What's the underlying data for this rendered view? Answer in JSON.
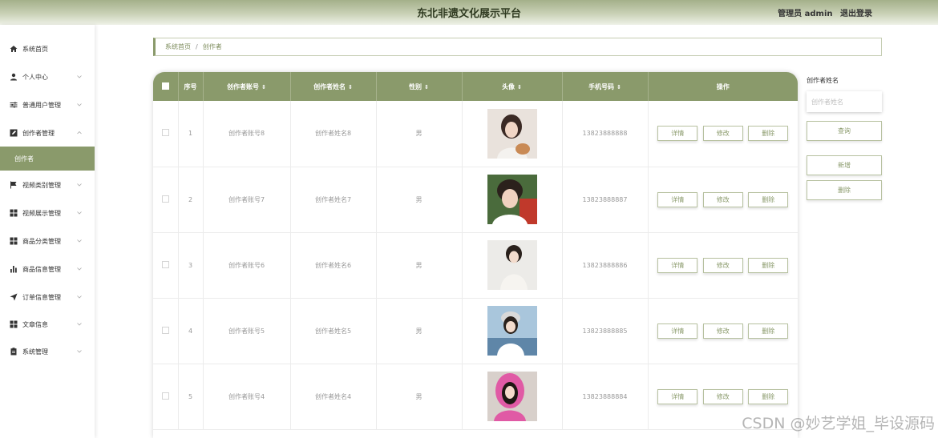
{
  "header": {
    "title": "东北非遗文化展示平台",
    "user": "管理员 admin",
    "logout": "退出登录"
  },
  "colors": {
    "accent": "#8a9a6b",
    "header_gradient_top": "#a4b08a"
  },
  "sidebar": {
    "items": [
      {
        "label": "系统首页",
        "icon": "home-icon"
      },
      {
        "label": "个人中心",
        "icon": "user-icon"
      },
      {
        "label": "普通用户管理",
        "icon": "sliders-icon"
      },
      {
        "label": "创作者管理",
        "icon": "edit-box-icon"
      },
      {
        "label": "创作者",
        "icon": ""
      },
      {
        "label": "视频类别管理",
        "icon": "flag-icon"
      },
      {
        "label": "视频展示管理",
        "icon": "grid-icon"
      },
      {
        "label": "商品分类管理",
        "icon": "grid-icon"
      },
      {
        "label": "商品信息管理",
        "icon": "bar-chart-icon"
      },
      {
        "label": "订单信息管理",
        "icon": "send-icon"
      },
      {
        "label": "文章信息",
        "icon": "grid-icon"
      },
      {
        "label": "系统管理",
        "icon": "clipboard-icon"
      }
    ]
  },
  "breadcrumb": {
    "home": "系统首页",
    "separator": "/",
    "current": "创作者"
  },
  "table": {
    "columns": {
      "index": "序号",
      "account": "创作者账号",
      "name": "创作者姓名",
      "gender": "性别",
      "avatar": "头像",
      "phone": "手机号码",
      "ops": "操作"
    },
    "sort_glyph": "⇕",
    "actions": {
      "detail": "详情",
      "edit": "修改",
      "delete": "删除"
    },
    "rows": [
      {
        "index": "1",
        "account": "创作者账号8",
        "name": "创作者姓名8",
        "gender": "男",
        "phone": "13823888888"
      },
      {
        "index": "2",
        "account": "创作者账号7",
        "name": "创作者姓名7",
        "gender": "男",
        "phone": "13823888887"
      },
      {
        "index": "3",
        "account": "创作者账号6",
        "name": "创作者姓名6",
        "gender": "男",
        "phone": "13823888886"
      },
      {
        "index": "4",
        "account": "创作者账号5",
        "name": "创作者姓名5",
        "gender": "男",
        "phone": "13823888885"
      },
      {
        "index": "5",
        "account": "创作者账号4",
        "name": "创作者姓名4",
        "gender": "男",
        "phone": "13823888884"
      }
    ]
  },
  "search": {
    "label": "创作者姓名",
    "placeholder": "创作者姓名",
    "query_button": "查询",
    "add_button": "新增",
    "delete_button": "删除"
  },
  "watermark": "CSDN @妙艺学姐_毕设源码"
}
